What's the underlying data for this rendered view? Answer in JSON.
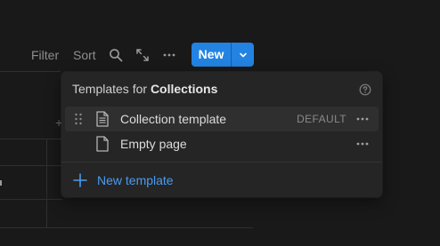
{
  "toolbar": {
    "filter_label": "Filter",
    "sort_label": "Sort",
    "new_label": "New",
    "icons": [
      "search-icon",
      "expand-icon",
      "more-icon",
      "chevron-down-icon"
    ],
    "accent_color": "#2383e2"
  },
  "table": {
    "add_symbol": "+"
  },
  "templates_menu": {
    "header_prefix": "Templates for ",
    "header_database": "Collections",
    "items": [
      {
        "label": "Collection template",
        "badge": "DEFAULT",
        "icon": "document-lines-icon"
      },
      {
        "label": "Empty page",
        "badge": "",
        "icon": "document-blank-icon"
      }
    ],
    "new_template_label": "New template",
    "link_color": "#4a9bef"
  }
}
